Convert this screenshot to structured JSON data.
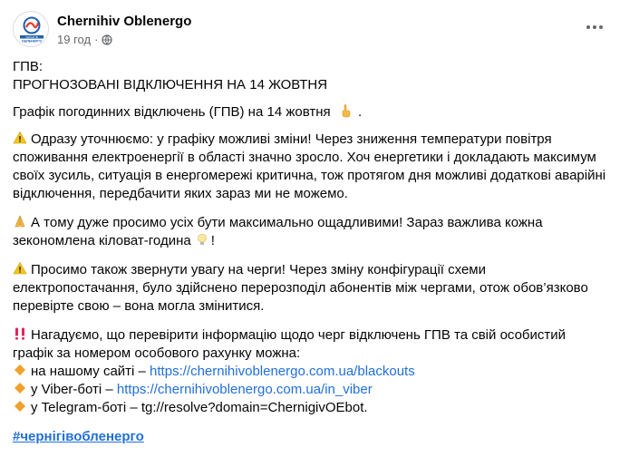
{
  "header": {
    "page_name": "Chernihiv Oblenergo",
    "time": "19 год",
    "dot": "·",
    "avatar_text_top": "ЧЕРНІГІВ",
    "avatar_text_bottom": "ОБЛЕНЕРГО",
    "icons": {
      "privacy": "globe-icon",
      "more": "more-options-icon"
    }
  },
  "post": {
    "title_line1": "ГПВ:",
    "title_line2": "ПРОГНОЗОВАНІ ВІДКЛЮЧЕННЯ НА 14 ЖОВТНЯ",
    "schedule_line": "Графік погодинних відключень (ГПВ) на 14 жовтня",
    "schedule_end": ".",
    "warning_lines": [
      "Одразу уточнюємо: у графіку можливі зміни! Через зниження температури повітря",
      "споживання електроенергії в області значно зросло. Хоч енергетики і докладають максимум",
      "своїх зусиль, ситуація в енергомережі критична, тож протягом дня можливі додаткові аварійні",
      "відключення, передбачити яких зараз ми не можемо."
    ],
    "please_lines": [
      "А тому дуже просимо усіх бути максимально ощадливими! Зараз важлива кожна",
      "зекономлена кіловат-година"
    ],
    "please_end": "!",
    "queues_lines": [
      "Просимо також звернути увагу на черги! Через зміну конфігурації схеми",
      "електропостачання, було здійснено перерозподіл абонентів між чергами, отож обов’язково",
      "перевірте свою – вона могла змінитися."
    ],
    "reminder_lines": [
      "Нагадуємо, що перевірити інформацію щодо черг відключень ГПВ та свій особистий",
      "графік за номером особового рахунку можна:"
    ],
    "links": [
      {
        "prefix": "на нашому сайті – ",
        "url": "https://chernihivoblenergo.com.ua/blackouts",
        "is_link": true
      },
      {
        "prefix": "у Viber-боті –  ",
        "url": "https://chernihivoblenergo.com.ua/in_viber",
        "is_link": true
      },
      {
        "prefix": "у Telegram-боті –  ",
        "url": "tg://resolve?domain=ChernigivOEbot.",
        "is_link": false
      }
    ],
    "hashtag": "#чернігівобленерго"
  },
  "colors": {
    "text": "#050505",
    "secondary": "#65676b",
    "link": "#216fdb",
    "warning": "#f5c518",
    "diamond": "#f0a12c",
    "alert": "#e0245e"
  }
}
